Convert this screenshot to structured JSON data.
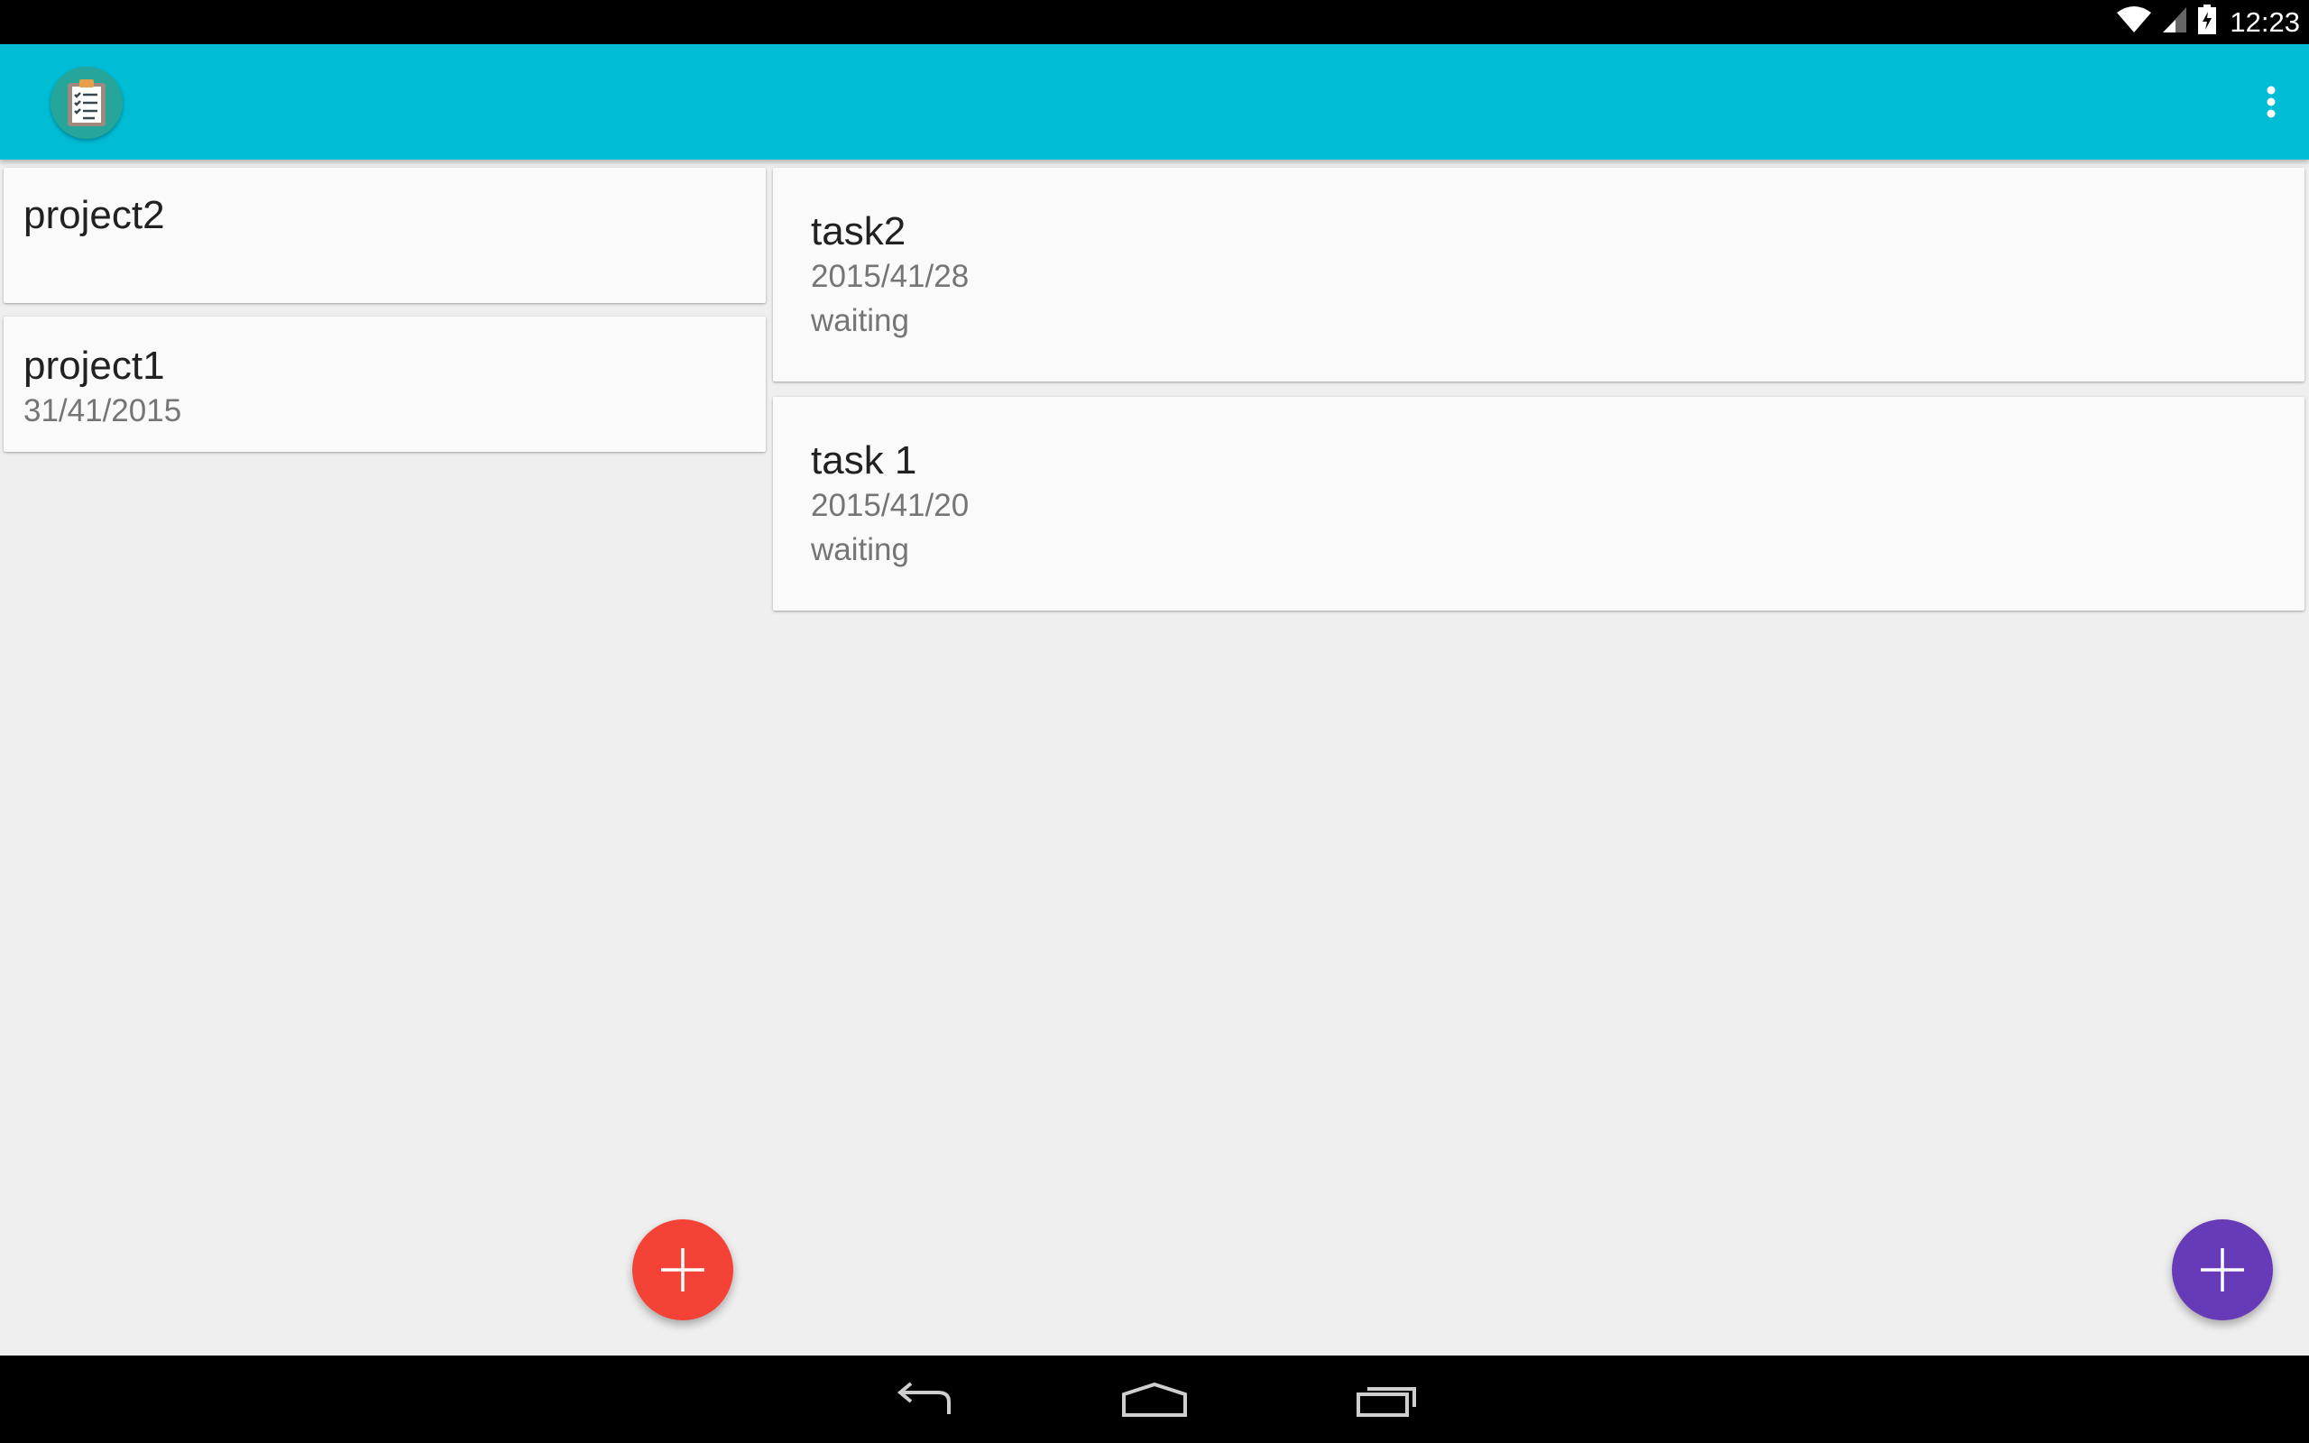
{
  "status_bar": {
    "time": "12:23",
    "icons": [
      "wifi-icon",
      "cell-signal-icon",
      "battery-charging-icon"
    ]
  },
  "app_bar": {
    "logo_icon": "clipboard-checklist-icon",
    "overflow_icon": "more-vert-icon",
    "color": "#00bcd4"
  },
  "projects": [
    {
      "name": "project2",
      "date": ""
    },
    {
      "name": "project1",
      "date": "31/41/2015"
    }
  ],
  "tasks": [
    {
      "name": "task2",
      "date": "2015/41/28",
      "status": "waiting"
    },
    {
      "name": "task 1",
      "date": "2015/41/20",
      "status": "waiting"
    }
  ],
  "fabs": {
    "add_project": {
      "icon": "plus-icon",
      "color": "#f44336"
    },
    "add_task": {
      "icon": "plus-icon",
      "color": "#673ab7"
    }
  },
  "nav_bar": {
    "icons": [
      "back-icon",
      "home-icon",
      "recent-apps-icon"
    ]
  }
}
